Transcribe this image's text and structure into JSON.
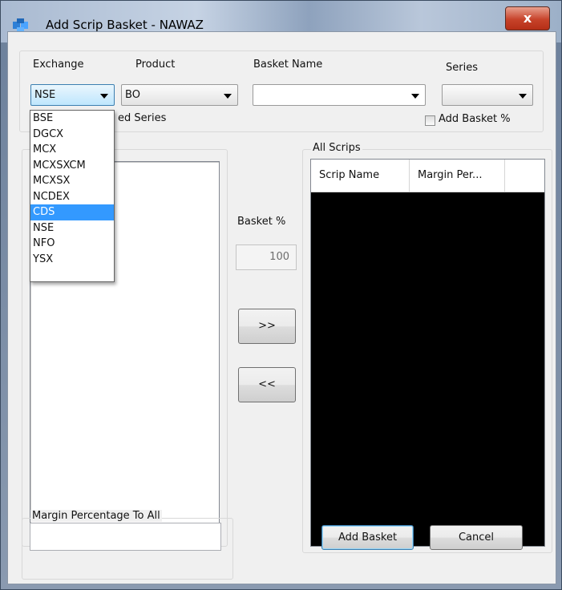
{
  "window": {
    "title": "Add Scrip Basket - NAWAZ",
    "close_label": "x"
  },
  "top": {
    "exchange_label": "Exchange",
    "product_label": "Product",
    "basket_name_label": "Basket Name",
    "series_label": "Series",
    "exchange_value": "NSE",
    "product_value": "BO",
    "basket_name_value": "",
    "series_value": "",
    "selected_series_label": "ed Series",
    "add_basket_pct_label": "Add Basket %"
  },
  "exchange_dropdown": {
    "options": [
      "BSE",
      "DGCX",
      "MCX",
      "MCXSXCM",
      "MCXSX",
      "NCDEX",
      "CDS",
      "NSE",
      "NFO",
      "YSX"
    ],
    "highlighted": "CDS"
  },
  "middle": {
    "basket_pct_label": "Basket %",
    "basket_pct_value": "100",
    "add_arrow": ">>",
    "remove_arrow": "<<"
  },
  "all_scrips": {
    "title": "All Scrips",
    "columns": [
      "Scrip Name",
      "Margin Per..."
    ]
  },
  "bottom": {
    "margin_pct_label": "Margin Percentage To All",
    "margin_pct_value": "",
    "add_basket_button": "Add Basket",
    "cancel_button": "Cancel"
  }
}
